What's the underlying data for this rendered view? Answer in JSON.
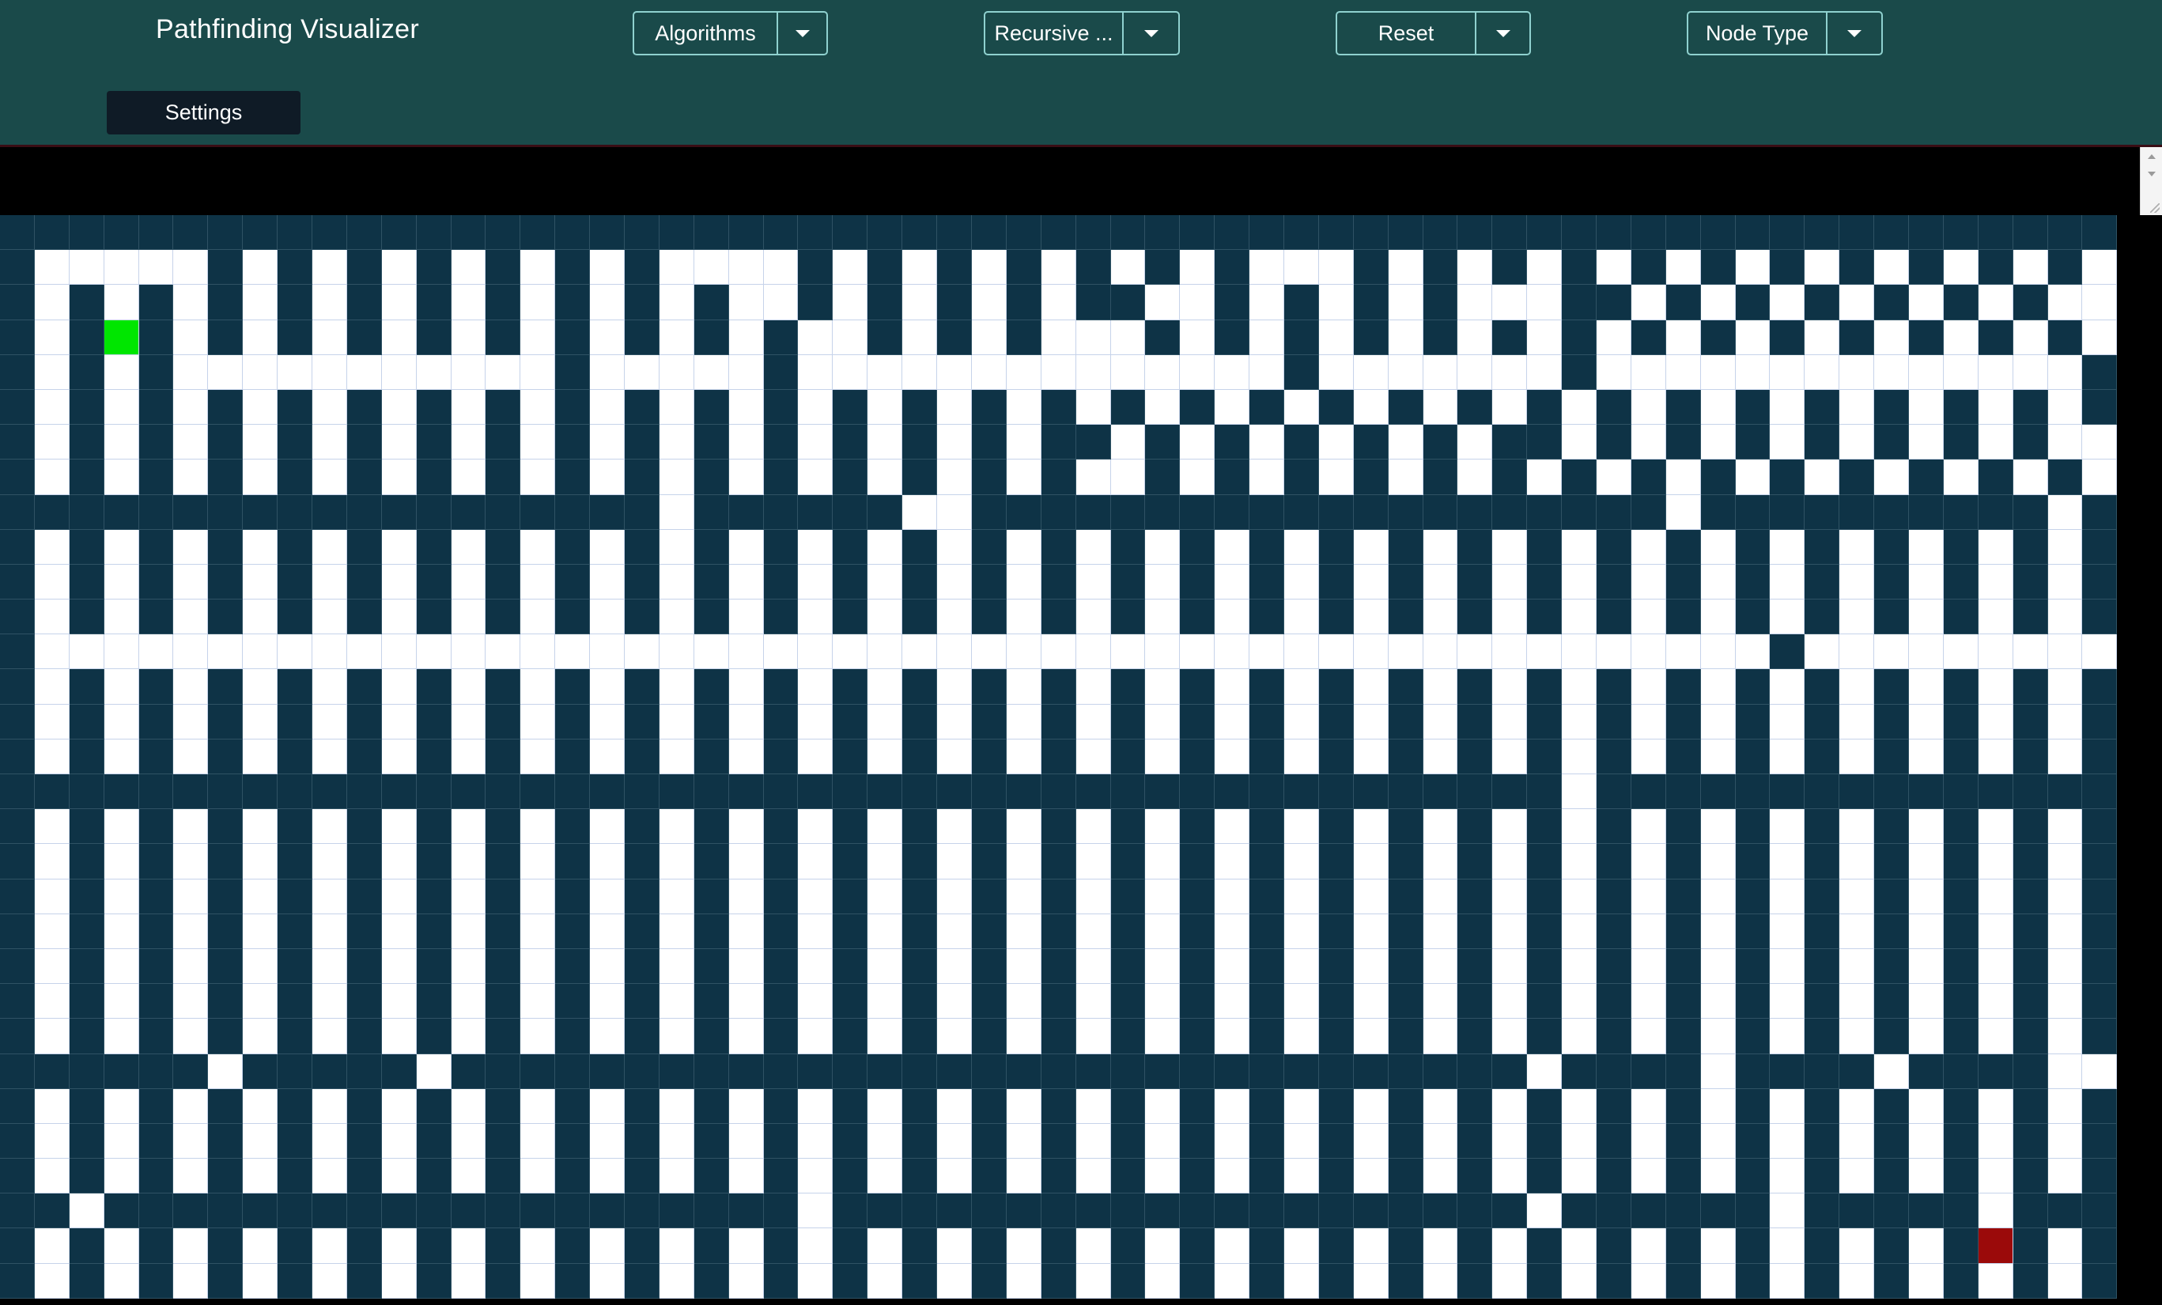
{
  "navbar": {
    "title": "Pathfinding Visualizer",
    "dropdowns": [
      {
        "id": "algorithms",
        "label": "Algorithms"
      },
      {
        "id": "maze",
        "label": "Recursive ..."
      },
      {
        "id": "reset",
        "label": "Reset"
      },
      {
        "id": "node-type",
        "label": "Node Type"
      }
    ],
    "settings_label": "Settings"
  },
  "colors": {
    "navbar_bg": "#1a4a4a",
    "wall": "#0e3346",
    "open": "#ffffff",
    "start": "#00e600",
    "end": "#9b0a0a",
    "grid_line": "#c6d3ea"
  },
  "icons": {
    "dropdown_caret": "caret-down-icon"
  },
  "grid": {
    "cols": 61,
    "rows": 31,
    "legend": {
      "#": "wall",
      ".": "open",
      "S": "start",
      "E": "end"
    },
    "map": [
      "#############################################################",
      "#.....#.#.#.#.#.#.#....#.#.#.#.#.#.#...#.#.#.#.#.#.#.#.#.#.#.",
      "#.#.#.#.#.#.#.#.#.#.#..#.#.#.#.##..#.#.#.#...##.#.#.#.#.#.#..",
      "#.#S#.#.#.#.#.#.#.#.#.#..#.#.#...#.#.#.#.#.#.#.#.#.#.#.#.#.#.",
      "#.#.#...........#.....#..............#.......#..............#",
      "#.#.#.#.#.#.#.#.#.#.#.#.#.#.#.#.#.#.#.#.#.#.#.#.#.#.#.#.#.#.#",
      "#.#.#.#.#.#.#.#.#.#.#.#.#.#.#.##.#.#.#.#.#.##.#.#.#.#.#.#.#..",
      "#.#.#.#.#.#.#.#.#.#.#.#.#.#.#.#..#.#.#.#.#.#.#.#.#.#.#.#.#.#.",
      "###################.######..####################.##########.#",
      "#.#.#.#.#.#.#.#.#.#.#.#.#.#.#.#.#.#.#.#.#.#.#.#.#.#.#.#.#.#.#",
      "#.#.#.#.#.#.#.#.#.#.#.#.#.#.#.#.#.#.#.#.#.#.#.#.#.#.#.#.#.#.#",
      "#.#.#.#.#.#.#.#.#.#.#.#.#.#.#.#.#.#.#.#.#.#.#.#.#.#.#.#.#.#.#",
      "#..................................................#.........#",
      "#.#.#.#.#.#.#.#.#.#.#.#.#.#.#.#.#.#.#.#.#.#.#.#.#.#.#.#.#.#.#",
      "#.#.#.#.#.#.#.#.#.#.#.#.#.#.#.#.#.#.#.#.#.#.#.#.#.#.#.#.#.#.#",
      "#.#.#.#.#.#.#.#.#.#.#.#.#.#.#.#.#.#.#.#.#.#.#.#.#.#.#.#.#.#.#",
      "#############################################.###############",
      "#.#.#.#.#.#.#.#.#.#.#.#.#.#.#.#.#.#.#.#.#.#.#.#.#.#.#.#.#.#.#",
      "#.#.#.#.#.#.#.#.#.#.#.#.#.#.#.#.#.#.#.#.#.#.#.#.#.#.#.#.#.#.#",
      "#.#.#.#.#.#.#.#.#.#.#.#.#.#.#.#.#.#.#.#.#.#.#.#.#.#.#.#.#.#.#",
      "#.#.#.#.#.#.#.#.#.#.#.#.#.#.#.#.#.#.#.#.#.#.#.#.#.#.#.#.#.#.#",
      "#.#.#.#.#.#.#.#.#.#.#.#.#.#.#.#.#.#.#.#.#.#.#.#.#.#.#.#.#.#.#",
      "#.#.#.#.#.#.#.#.#.#.#.#.#.#.#.#.#.#.#.#.#.#.#.#.#.#.#.#.#.#.#",
      "#.#.#.#.#.#.#.#.#.#.#.#.#.#.#.#.#.#.#.#.#.#.#.#.#.#.#.#.#.#.#",
      "######.#####.###############################.####.####.####..",
      "#.#.#.#.#.#.#.#.#.#.#.#.#.#.#.#.#.#.#.#.#.#.#.#.#.#.#.#.#.#.#",
      "#.#.#.#.#.#.#.#.#.#.#.#.#.#.#.#.#.#.#.#.#.#.#.#.#.#.#.#.#.#.#",
      "#.#.#.#.#.#.#.#.#.#.#.#.#.#.#.#.#.#.#.#.#.#.#.#.#.#.#.#.#.#.#",
      "##.####################.####################.######.#####.###",
      "#.#.#.#.#.#.#.#.#.#.#.#.#.#.#.#.#.#.#.#.#.#.#.#.#.#.#.#.#E#.#",
      "#.#.#.#.#.#.#.#.#.#.#.#.#.#.#.#.#.#.#.#.#.#.#.#.#.#.#.#.#.#.#"
    ]
  }
}
